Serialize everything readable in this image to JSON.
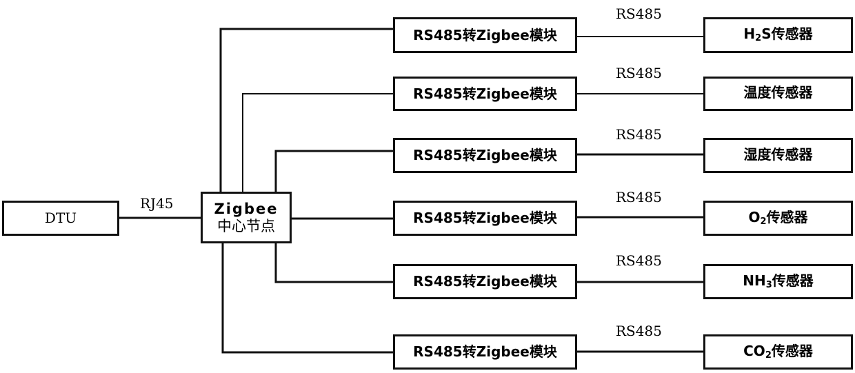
{
  "diagram": {
    "dtu": {
      "label": "DTU"
    },
    "link_dtu_hub": "RJ45",
    "hub": {
      "line1": "Zigbee",
      "line2": "中心节点"
    },
    "branches": [
      {
        "module": "RS485转Zigbee模块",
        "link": "RS485",
        "sensor_prefix": "H",
        "sensor_sub": "2",
        "sensor_suffix": "S传感器"
      },
      {
        "module": "RS485转Zigbee模块",
        "link": "RS485",
        "sensor_prefix": "温度传感器",
        "sensor_sub": "",
        "sensor_suffix": ""
      },
      {
        "module": "RS485转Zigbee模块",
        "link": "RS485",
        "sensor_prefix": "湿度传感器",
        "sensor_sub": "",
        "sensor_suffix": ""
      },
      {
        "module": "RS485转Zigbee模块",
        "link": "RS485",
        "sensor_prefix": "O",
        "sensor_sub": "2",
        "sensor_suffix": "传感器"
      },
      {
        "module": "RS485转Zigbee模块",
        "link": "RS485",
        "sensor_prefix": "NH",
        "sensor_sub": "3",
        "sensor_suffix": "传感器"
      },
      {
        "module": "RS485转Zigbee模块",
        "link": "RS485",
        "sensor_prefix": "CO",
        "sensor_sub": "2",
        "sensor_suffix": "传感器"
      }
    ]
  }
}
